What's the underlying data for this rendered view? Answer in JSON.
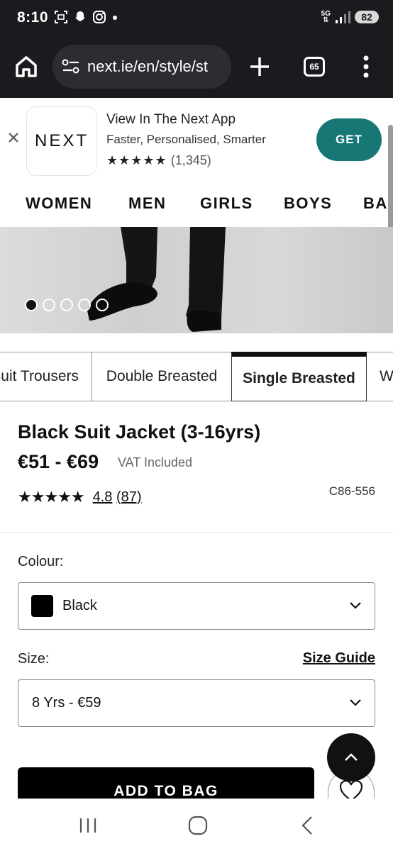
{
  "status_bar": {
    "time": "8:10",
    "network": "5G",
    "battery": "82"
  },
  "browser": {
    "url": "next.ie/en/style/st",
    "tab_count": "65"
  },
  "app_banner": {
    "logo_text": "NEXT",
    "title": "View In The Next App",
    "subtitle": "Faster, Personalised, Smarter",
    "stars": "★★★★★",
    "review_count": "(1,345)",
    "get_label": "GET"
  },
  "categories": [
    "WOMEN",
    "MEN",
    "GIRLS",
    "BOYS",
    "BABY"
  ],
  "carousel": {
    "slide_count": 5,
    "active_index": 0
  },
  "style_tabs": [
    "Suit Trousers",
    "Double Breasted",
    "Single Breasted",
    "Waistcoats"
  ],
  "style_tabs_active": "Single Breasted",
  "product": {
    "title": "Black Suit Jacket (3-16yrs)",
    "price": "€51 - €69",
    "vat": "VAT Included",
    "stars": "★★★★★",
    "rating": "4.8",
    "rating_count": "(87)",
    "code": "C86-556"
  },
  "colour": {
    "label": "Colour:",
    "value": "Black",
    "swatch": "#000000"
  },
  "size": {
    "label": "Size:",
    "guide_label": "Size Guide",
    "value": "8 Yrs - €59"
  },
  "actions": {
    "add_to_bag": "ADD TO BAG"
  },
  "colors": {
    "get_button": "#177775",
    "chrome_dark": "#1b1b1f"
  }
}
